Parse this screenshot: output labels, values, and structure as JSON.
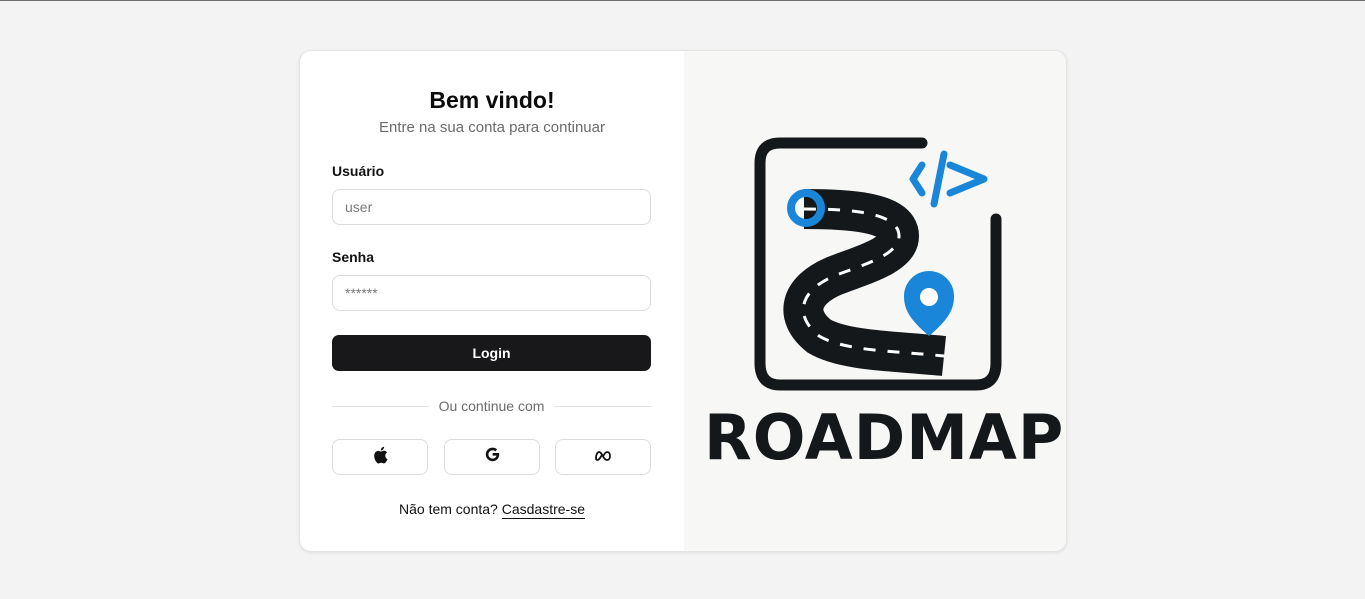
{
  "header": {
    "title": "Bem vindo!",
    "subtitle": "Entre na sua conta para continuar"
  },
  "form": {
    "username_label": "Usuário",
    "username_placeholder": "user",
    "password_label": "Senha",
    "password_placeholder": "******",
    "login_label": "Login"
  },
  "divider": {
    "text": "Ou continue com"
  },
  "social": [
    {
      "icon": "apple-icon"
    },
    {
      "icon": "google-icon"
    },
    {
      "icon": "meta-icon"
    }
  ],
  "footer": {
    "prompt": "Não tem conta?",
    "signup_link": "Casdastre-se"
  },
  "brand": {
    "name": "ROADMAP",
    "code_symbol": "</>",
    "colors": {
      "accent": "#1a86d9",
      "dark": "#14181b",
      "button": "#18181b"
    }
  }
}
